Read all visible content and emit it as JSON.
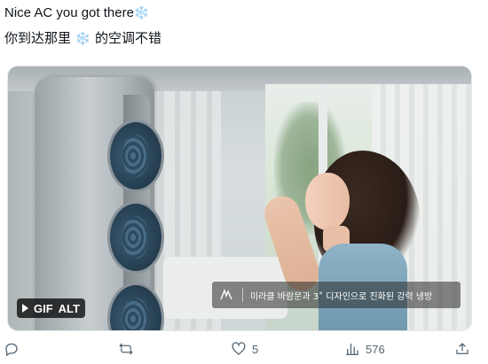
{
  "post": {
    "line1": "Nice AC you got there",
    "line1_emoji": "❄️",
    "line2_before": "你到达那里",
    "line2_emoji": "❄️",
    "line2_after": "的空调不错"
  },
  "media": {
    "badge_gif": "GIF",
    "badge_alt": "ALT",
    "caption_text": "미라클 바람문과 3˚ 디자인으로 진화된 강력 냉방"
  },
  "actions": {
    "reply_icon": "reply-icon",
    "repost_icon": "repost-icon",
    "like_icon": "heart-icon",
    "like_count": "5",
    "views_icon": "views-icon",
    "view_count": "576",
    "share_icon": "share-icon"
  },
  "colors": {
    "text": "#0f1419",
    "muted": "#536471",
    "snowflake": "#5fb3f5"
  }
}
